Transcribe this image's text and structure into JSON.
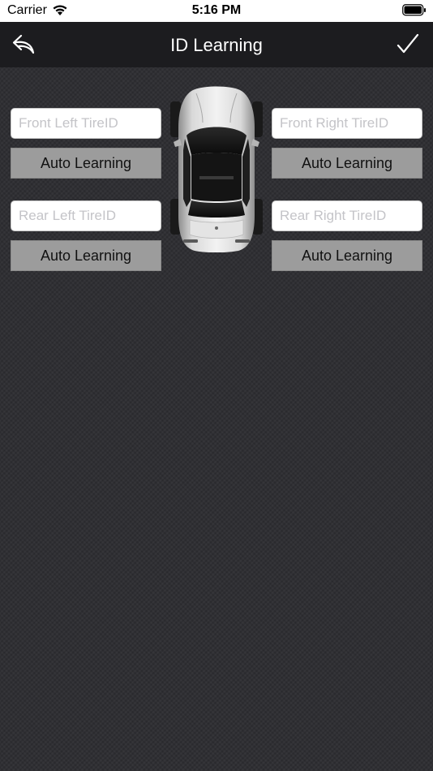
{
  "status_bar": {
    "carrier": "Carrier",
    "time": "5:16 PM",
    "wifi_icon": "wifi-icon",
    "battery_icon": "battery-icon"
  },
  "nav": {
    "title": "ID Learning",
    "back_icon": "back-arrow-icon",
    "confirm_icon": "checkmark-icon"
  },
  "tires": {
    "front_left": {
      "placeholder": "Front Left TireID",
      "value": "",
      "button_label": "Auto Learning"
    },
    "front_right": {
      "placeholder": "Front Right TireID",
      "value": "",
      "button_label": "Auto Learning"
    },
    "rear_left": {
      "placeholder": "Rear Left TireID",
      "value": "",
      "button_label": "Auto Learning"
    },
    "rear_right": {
      "placeholder": "Rear Right TireID",
      "value": "",
      "button_label": "Auto Learning"
    }
  },
  "colors": {
    "background": "#2f2f33",
    "nav_background": "#1c1c1f",
    "button_background": "#9c9c9c"
  }
}
